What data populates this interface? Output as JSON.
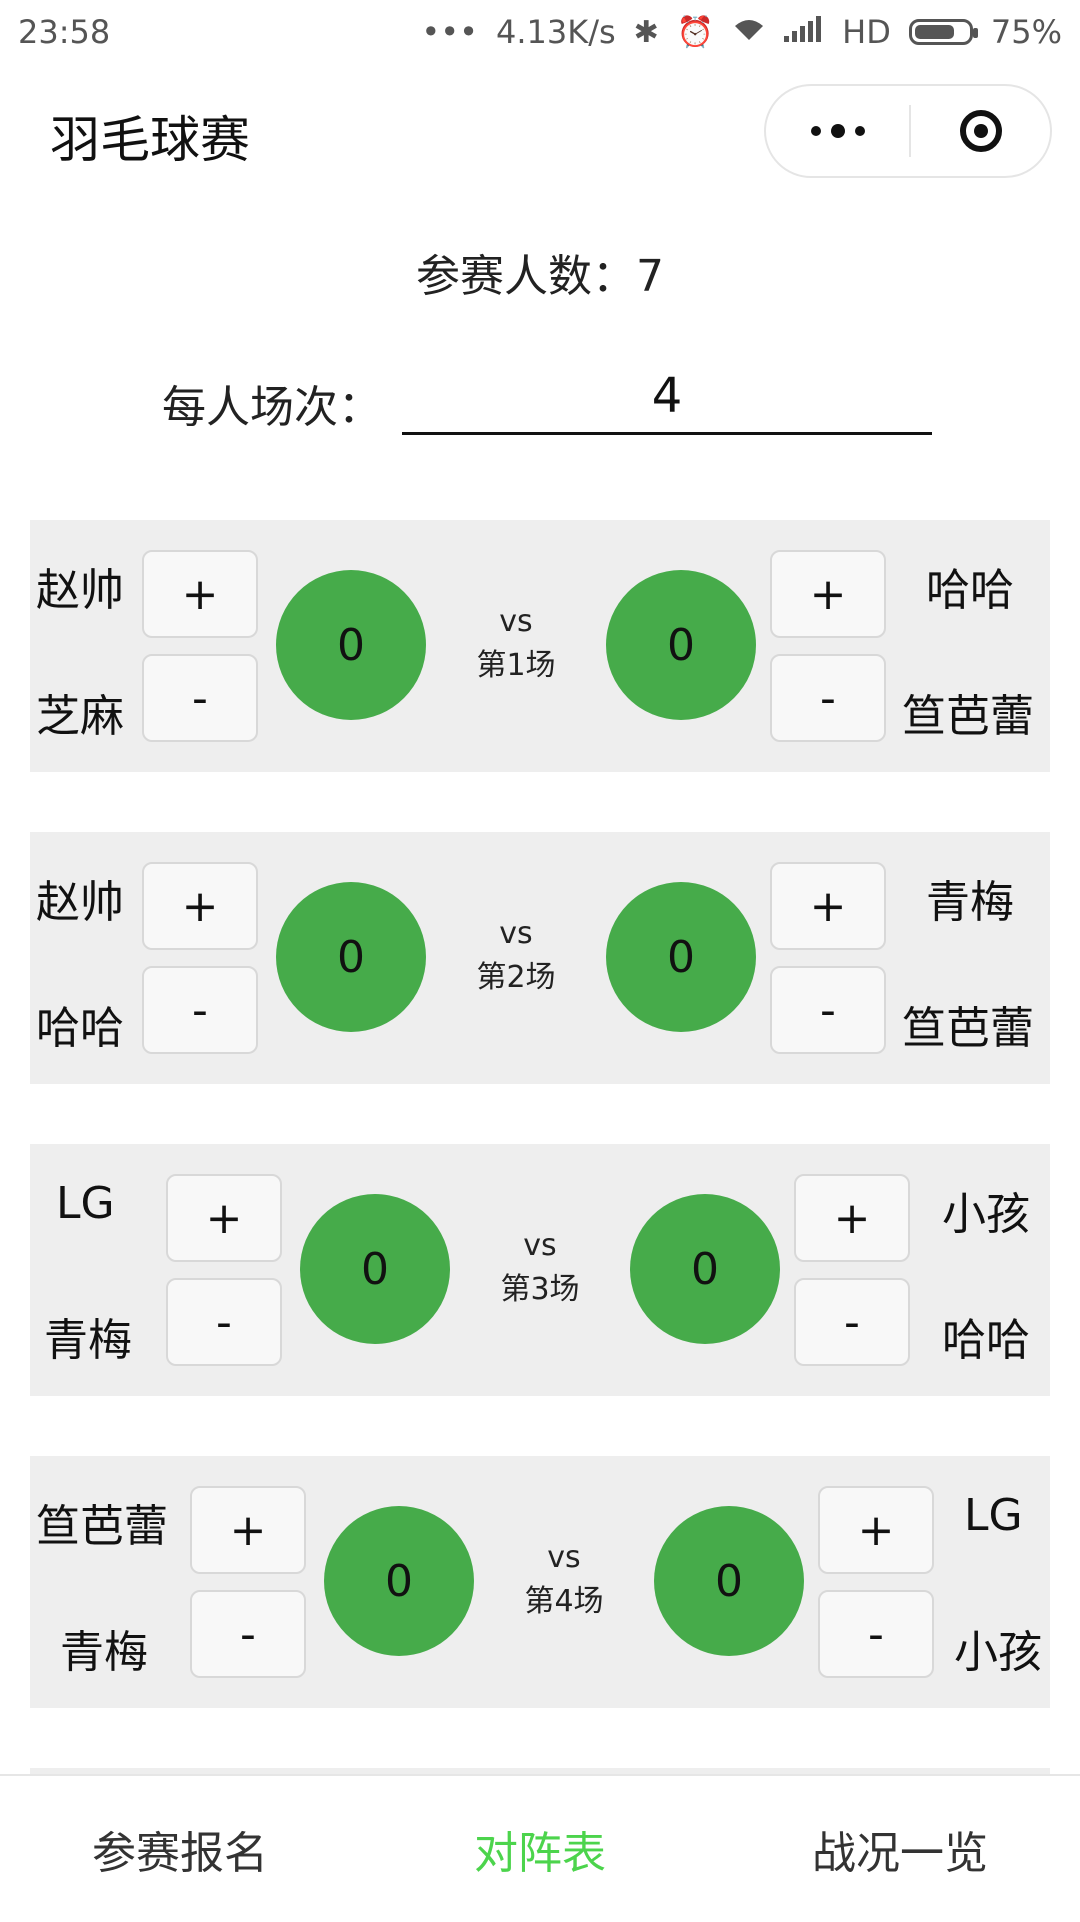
{
  "status_bar": {
    "time": "23:58",
    "dots": "•••",
    "network_speed": "4.13K/s",
    "hd": "HD",
    "battery": "75%",
    "battery_level": 0.75
  },
  "nav": {
    "title": "羽毛球赛"
  },
  "summary": {
    "participants_text": "参赛人数：7",
    "per_person_label": "每人场次：",
    "per_person_value": "4"
  },
  "matches": [
    {
      "left_top": "赵帅",
      "left_bottom": "芝麻",
      "right_top": "哈哈",
      "right_bottom": "笪芭蕾",
      "left_score": "0",
      "right_score": "0",
      "vs": "vs",
      "round": "第1场",
      "plus": "+",
      "minus": "-"
    },
    {
      "left_top": "赵帅",
      "left_bottom": "哈哈",
      "right_top": "青梅",
      "right_bottom": "笪芭蕾",
      "left_score": "0",
      "right_score": "0",
      "vs": "vs",
      "round": "第2场",
      "plus": "+",
      "minus": "-"
    },
    {
      "left_top": "LG",
      "left_bottom": "青梅",
      "right_top": "小孩",
      "right_bottom": "哈哈",
      "left_score": "0",
      "right_score": "0",
      "vs": "vs",
      "round": "第3场",
      "plus": "+",
      "minus": "-"
    },
    {
      "left_top": "笪芭蕾",
      "left_bottom": "青梅",
      "right_top": "LG",
      "right_bottom": "小孩",
      "left_score": "0",
      "right_score": "0",
      "vs": "vs",
      "round": "第4场",
      "plus": "+",
      "minus": "-"
    }
  ],
  "tabbar": {
    "items": [
      {
        "label": "参赛报名",
        "active": false
      },
      {
        "label": "对阵表",
        "active": true
      },
      {
        "label": "战况一览",
        "active": false
      }
    ],
    "active_color": "#4cd44c"
  },
  "colors": {
    "score_circle": "#46ab4a",
    "card_bg": "#eeeeee"
  }
}
